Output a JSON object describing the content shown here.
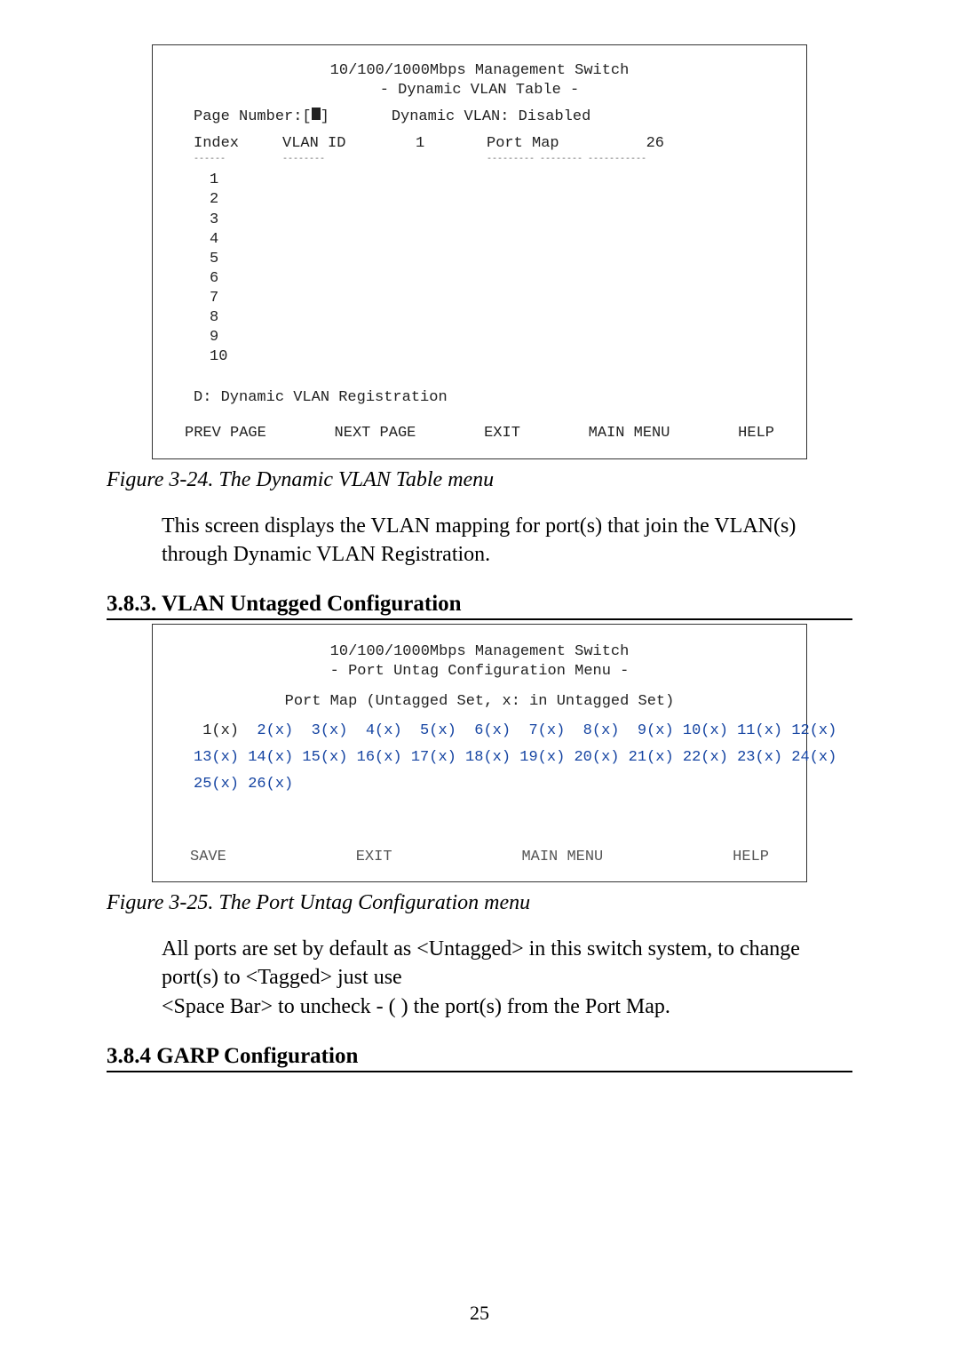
{
  "terminal1": {
    "title_line1": "10/100/1000Mbps Management Switch",
    "title_line2": "- Dynamic VLAN Table -",
    "page_number_label": "Page Number:[",
    "page_number_suffix": "]",
    "dynamic_vlan_label": "Dynamic VLAN: Disabled",
    "headers": {
      "index": "Index",
      "vlan_id": "VLAN ID",
      "one": "1",
      "port_map": "Port Map",
      "count": "26"
    },
    "index_values": [
      "1",
      "2",
      "3",
      "4",
      "5",
      "6",
      "7",
      "8",
      "9",
      "10"
    ],
    "d_line": "D: Dynamic VLAN Registration",
    "menu": {
      "prev": "PREV PAGE",
      "next": "NEXT PAGE",
      "exit": "EXIT",
      "main": "MAIN MENU",
      "help": "HELP"
    }
  },
  "caption1": "Figure 3-24. The Dynamic VLAN Table menu",
  "body1": "This screen displays the VLAN mapping for port(s) that join the VLAN(s) through Dynamic VLAN Registration.",
  "heading383": "3.8.3.   VLAN Untagged Configuration",
  "terminal2": {
    "title_line1": "10/100/1000Mbps Management Switch",
    "title_line2": "- Port Untag Configuration Menu -",
    "subheader": "Port Map (Untagged Set, x: in Untagged Set)",
    "row1_first": " 1(x)",
    "row1_rest": "  2(x)  3(x)  4(x)  5(x)  6(x)  7(x)  8(x)  9(x) 10(x) 11(x) 12(x)",
    "row2": "13(x) 14(x) 15(x) 16(x) 17(x) 18(x) 19(x) 20(x) 21(x) 22(x) 23(x) 24(x)",
    "row3": "25(x) 26(x)",
    "menu": {
      "save": "SAVE",
      "exit": "EXIT",
      "main": "MAIN MENU",
      "help": "HELP"
    }
  },
  "caption2": "Figure 3-25. The Port Untag Configuration menu",
  "body2_line1": "All ports are set by default as <Untagged> in this switch system, to change port(s) to <Tagged> just use",
  "body2_line2": "<Space Bar> to uncheck - ( ) the port(s) from the Port Map.",
  "heading384": "3.8.4   GARP Configuration",
  "page_number": "25"
}
